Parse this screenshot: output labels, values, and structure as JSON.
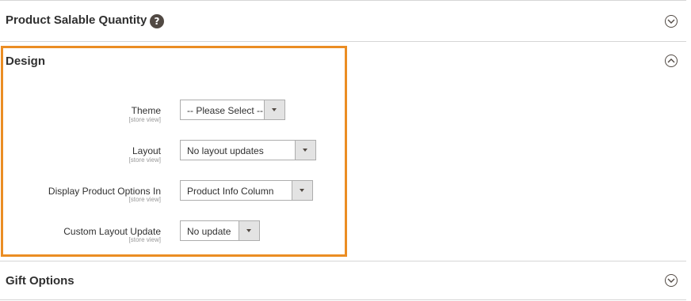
{
  "sections": {
    "salable": {
      "title": "Product Salable Quantity",
      "help_icon": "?",
      "toggle_icon": "chevron-down-circle-icon"
    },
    "design": {
      "title": "Design",
      "toggle_icon": "chevron-up-circle-icon"
    },
    "gift": {
      "title": "Gift Options",
      "toggle_icon": "chevron-down-circle-icon"
    }
  },
  "fields": {
    "theme": {
      "label": "Theme",
      "scope": "[store view]",
      "value": "-- Please Select --"
    },
    "layout": {
      "label": "Layout",
      "scope": "[store view]",
      "value": "No layout updates"
    },
    "display_options": {
      "label": "Display Product Options In",
      "scope": "[store view]",
      "value": "Product Info Column"
    },
    "custom_layout": {
      "label": "Custom Layout Update",
      "scope": "[store view]",
      "value": "No update"
    }
  },
  "colors": {
    "highlight": "#eb8d23",
    "icon_dark": "#514943"
  }
}
